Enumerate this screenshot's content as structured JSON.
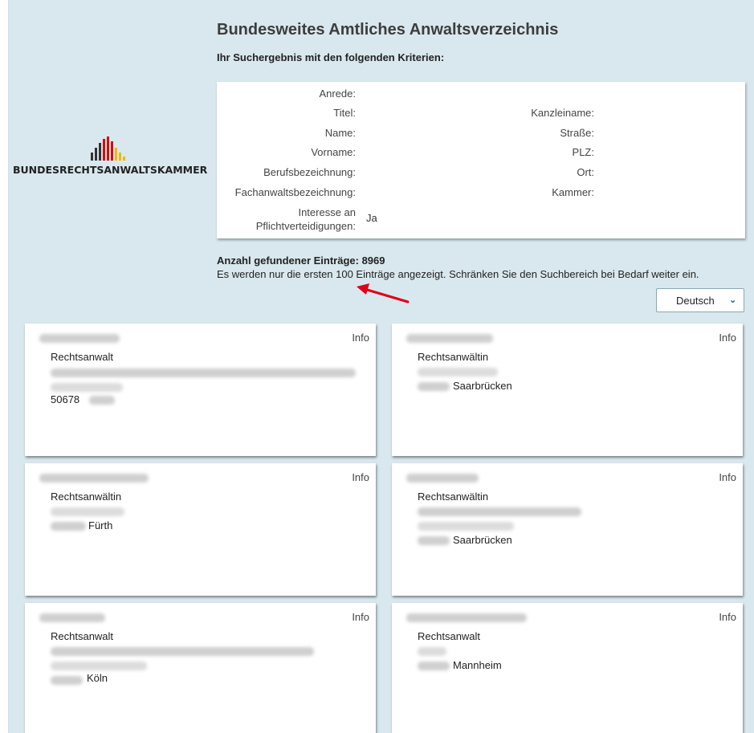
{
  "header": {
    "title": "Bundesweites Amtliches Anwaltsverzeichnis",
    "subtitle": "Ihr Suchergebnis mit den folgenden Kriterien:"
  },
  "logo": {
    "text": "BUNDESRECHTSANWALTSKAMMER"
  },
  "criteria": {
    "left": [
      {
        "label": "Anrede:"
      },
      {
        "label": "Titel:"
      },
      {
        "label": "Name:"
      },
      {
        "label": "Vorname:"
      },
      {
        "label": "Berufsbezeichnung:"
      },
      {
        "label": "Fachanwaltsbezeichnung:"
      },
      {
        "label_line1": "Interesse an",
        "label_line2": "Pflichtverteidigungen:",
        "value": "Ja"
      }
    ],
    "right": [
      {
        "label": "Kanzleiname:"
      },
      {
        "label": "Straße:"
      },
      {
        "label": "PLZ:"
      },
      {
        "label": "Ort:"
      },
      {
        "label": "Kammer:"
      }
    ]
  },
  "results": {
    "count_text": "Anzahl gefundener Einträge: 8969",
    "notice": "Es werden nur die ersten 100 Einträge angezeigt. Schränken Sie den Suchbereich bei Bedarf weiter ein."
  },
  "language": {
    "selected": "Deutsch"
  },
  "cards": [
    {
      "info": "Info",
      "job": "Rechtsanwalt",
      "city": "50678"
    },
    {
      "info": "Info",
      "job": "Rechtsanwältin",
      "city": "Saarbrücken"
    },
    {
      "info": "Info",
      "job": "Rechtsanwältin",
      "city": "Fürth"
    },
    {
      "info": "Info",
      "job": "Rechtsanwältin",
      "city": "Saarbrücken"
    },
    {
      "info": "Info",
      "job": "Rechtsanwalt",
      "city": "Köln"
    },
    {
      "info": "Info",
      "job": "Rechtsanwalt",
      "city": "Mannheim"
    }
  ],
  "colors": {
    "background": "#d9e8ee",
    "arrow": "#e0001b",
    "logo_dark": "#333333",
    "logo_red": "#dd0000",
    "logo_gold": "#ffcc00"
  }
}
